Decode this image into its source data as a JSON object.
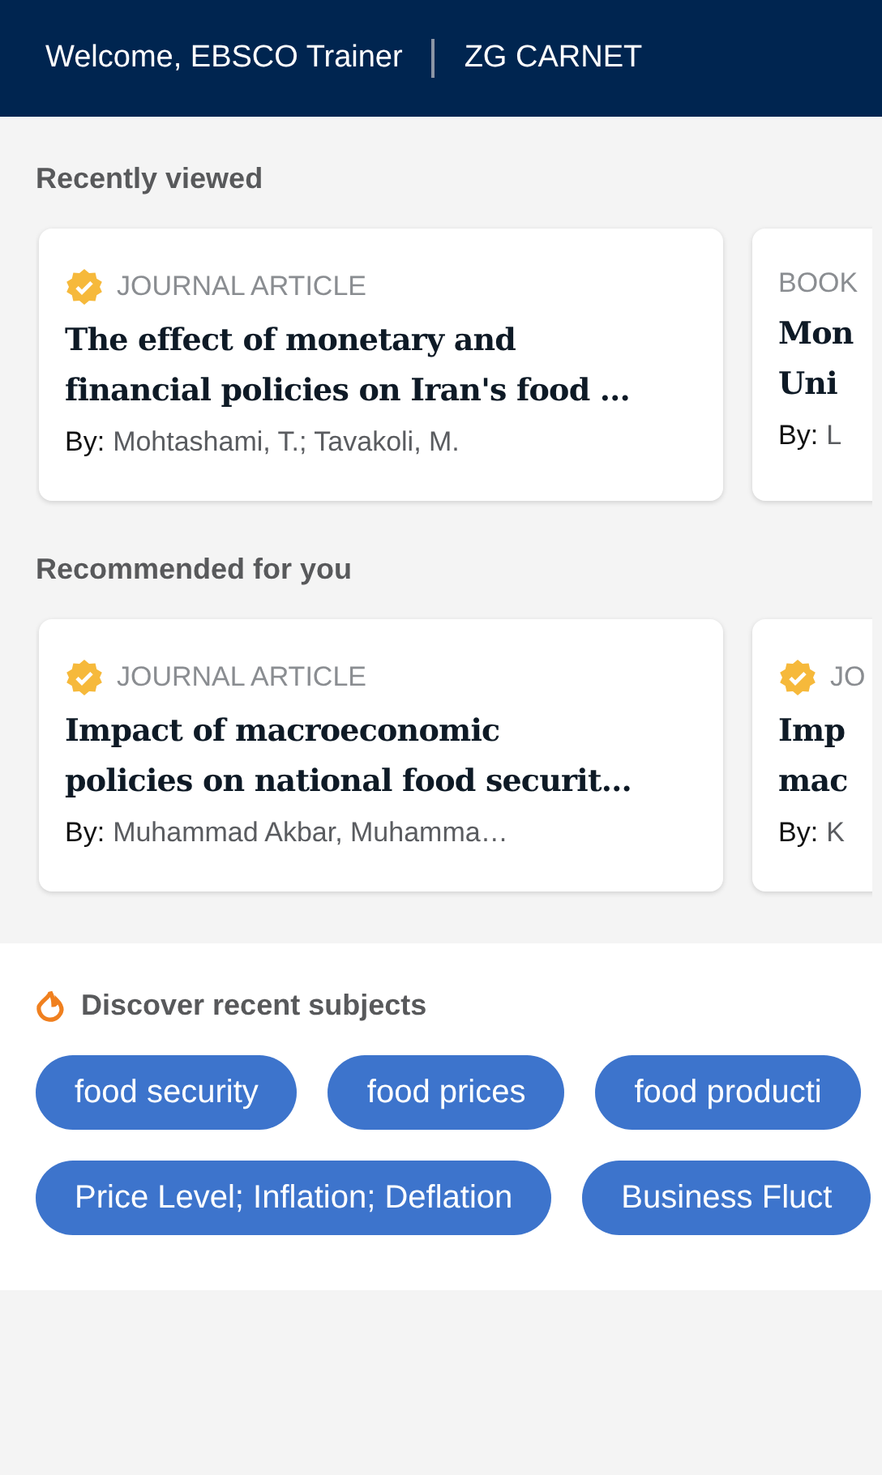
{
  "header": {
    "welcome": "Welcome, EBSCO Trainer",
    "institution": "ZG CARNET"
  },
  "sections": [
    {
      "title": "Recently viewed",
      "cards": [
        {
          "type": "JOURNAL ARTICLE",
          "verified": true,
          "title_lines": [
            "The effect of monetary and",
            "financial policies on Iran's food …"
          ],
          "by": "By:",
          "authors": "Mohtashami, T.; Tavakoli, M."
        },
        {
          "type": "BOOK",
          "verified": false,
          "title_lines": [
            "Mon",
            "Uni"
          ],
          "by": "By:",
          "authors": "L"
        }
      ]
    },
    {
      "title": "Recommended for you",
      "cards": [
        {
          "type": "JOURNAL ARTICLE",
          "verified": true,
          "title_lines": [
            "Impact of macroeconomic",
            "policies on national food securit…"
          ],
          "by": "By:",
          "authors": "Muhammad Akbar, Muhamma…"
        },
        {
          "type": "JO",
          "verified": true,
          "title_lines": [
            "Imp",
            "mac"
          ],
          "by": "By:",
          "authors": "K"
        }
      ]
    }
  ],
  "subjects": {
    "title": "Discover recent subjects",
    "lines": [
      {
        "chips": [
          "food security",
          "food prices",
          "food producti"
        ]
      },
      {
        "chips": [
          "Price Level; Inflation; Deflation",
          "Business Fluct"
        ]
      }
    ]
  }
}
